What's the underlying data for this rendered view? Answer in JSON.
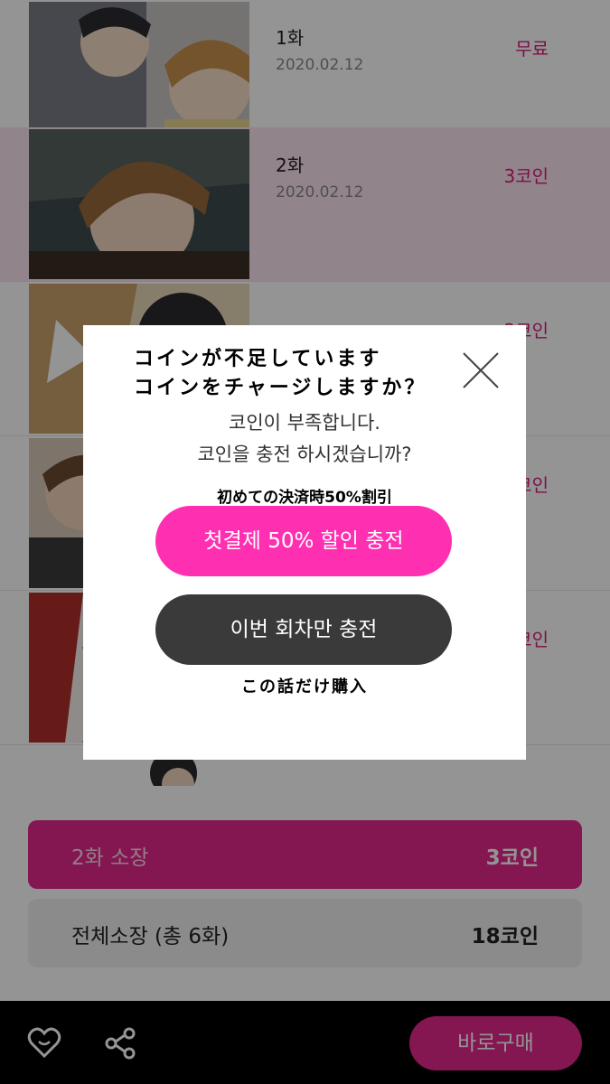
{
  "episodes": [
    {
      "title": "1화",
      "date": "2020.02.12",
      "price": "무료"
    },
    {
      "title": "2화",
      "date": "2020.02.12",
      "price": "3코인"
    },
    {
      "title": "",
      "date": "",
      "price": "3코인"
    },
    {
      "title": "",
      "date": "",
      "price": "3코인"
    },
    {
      "title": "",
      "date": "",
      "price": "3코인"
    }
  ],
  "purchase": {
    "single_label": "2화 소장",
    "single_price": "3코인",
    "all_label": "전체소장 (총 6화)",
    "all_price": "18코인"
  },
  "bottom_bar": {
    "buy_now": "바로구매",
    "icons": [
      "heart-icon",
      "share-icon"
    ]
  },
  "modal": {
    "jp_title_line1": "コインが不足しています",
    "jp_title_line2": "コインをチャージしますか？",
    "ko_line1": "코인이 부족합니다.",
    "ko_line2": "코인을 충전 하시겠습니까?",
    "jp_discount": "初めての決済時50%割引",
    "discount_button": "첫결제 50% 할인 충전",
    "single_charge_button": "이번 회차만 충전",
    "jp_single": "この話だけ購入"
  },
  "colors": {
    "accent": "#e4288c",
    "button_pink": "#ff2fb1",
    "button_dark": "#3a3a3a"
  }
}
